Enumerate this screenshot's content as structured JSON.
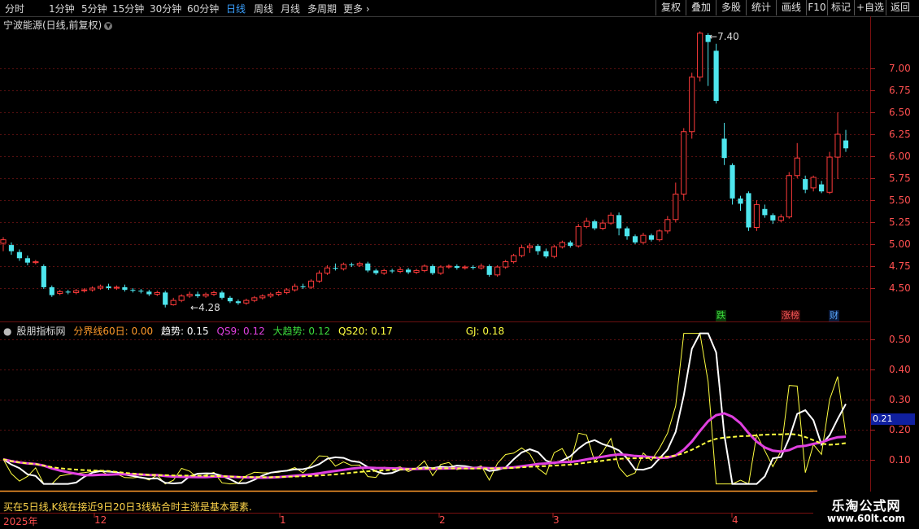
{
  "toolbar": {
    "periods": [
      "分时",
      "1分钟",
      "5分钟",
      "15分钟",
      "30分钟",
      "60分钟",
      "日线",
      "周线",
      "月线",
      "多周期",
      "更多"
    ],
    "active_period": "日线",
    "right_buttons": [
      "复权",
      "叠加",
      "多股",
      "统计",
      "画线",
      "F10",
      "标记",
      "+自选",
      "返回"
    ]
  },
  "chart_title": "宁波能源(日线,前复权)",
  "price_axis": [
    "7.00",
    "6.75",
    "6.50",
    "6.25",
    "6.00",
    "5.75",
    "5.50",
    "5.25",
    "5.00",
    "4.75",
    "4.50"
  ],
  "high_label": "7.40",
  "low_label": "4.28",
  "badges": [
    {
      "text": "跌",
      "color": "#3ddc3d",
      "bg": "#0a3a0a"
    },
    {
      "text": "涨榜",
      "color": "#ff5a5a",
      "bg": "#3a0a0a"
    },
    {
      "text": "财",
      "color": "#5aa8ff",
      "bg": "#0a1a3a"
    }
  ],
  "indicator": {
    "name": "股朋指标网",
    "fen_jie": "分界线60日: 0.00",
    "qu_shi_label": "趋势:",
    "qu_shi_value": "0.15",
    "qs9": "QS9: 0.12",
    "da_qu_shi": "大趋势: 0.12",
    "qs20": "QS20: 0.17",
    "gj": "GJ: 0.18",
    "axis": [
      "0.50",
      "0.40",
      "0.30",
      "0.20",
      "0.10"
    ],
    "current_value": "0.21"
  },
  "time_axis": [
    "2025年",
    "12",
    "1",
    "2",
    "3",
    "4"
  ],
  "bottom_text": "买在5日线,K线在接近9日20日3线粘合时主涨是基本要素.",
  "watermark": {
    "line1": "乐淘公式网",
    "line2": "www.60lt.com"
  },
  "colors": {
    "up": "#ff3b3b",
    "down": "#4ee6ee",
    "white": "#ffffff",
    "magenta": "#e040e0",
    "yellow": "#ffff40",
    "orange": "#ff9a2a"
  },
  "candles": [
    [
      5.01,
      5.05,
      4.92,
      5.08
    ],
    [
      4.99,
      4.92,
      4.88,
      5.02
    ],
    [
      4.91,
      4.84,
      4.81,
      4.94
    ],
    [
      4.84,
      4.79,
      4.76,
      4.87
    ],
    [
      4.79,
      4.8,
      4.77,
      4.82
    ],
    [
      4.75,
      4.51,
      4.49,
      4.77
    ],
    [
      4.51,
      4.42,
      4.4,
      4.53
    ],
    [
      4.44,
      4.46,
      4.42,
      4.48
    ],
    [
      4.46,
      4.45,
      4.43,
      4.48
    ],
    [
      4.45,
      4.47,
      4.43,
      4.49
    ],
    [
      4.47,
      4.48,
      4.45,
      4.5
    ],
    [
      4.48,
      4.5,
      4.46,
      4.52
    ],
    [
      4.5,
      4.52,
      4.48,
      4.54
    ],
    [
      4.52,
      4.5,
      4.48,
      4.55
    ],
    [
      4.5,
      4.51,
      4.48,
      4.53
    ],
    [
      4.51,
      4.48,
      4.46,
      4.54
    ],
    [
      4.48,
      4.47,
      4.45,
      4.5
    ],
    [
      4.47,
      4.46,
      4.44,
      4.49
    ],
    [
      4.46,
      4.43,
      4.41,
      4.48
    ],
    [
      4.43,
      4.45,
      4.41,
      4.47
    ],
    [
      4.45,
      4.31,
      4.28,
      4.47
    ],
    [
      4.31,
      4.36,
      4.3,
      4.39
    ],
    [
      4.36,
      4.41,
      4.34,
      4.43
    ],
    [
      4.41,
      4.43,
      4.39,
      4.46
    ],
    [
      4.43,
      4.41,
      4.39,
      4.46
    ],
    [
      4.41,
      4.43,
      4.39,
      4.45
    ],
    [
      4.43,
      4.45,
      4.41,
      4.47
    ],
    [
      4.45,
      4.39,
      4.37,
      4.47
    ],
    [
      4.39,
      4.35,
      4.33,
      4.41
    ],
    [
      4.35,
      4.33,
      4.31,
      4.37
    ],
    [
      4.33,
      4.36,
      4.31,
      4.38
    ],
    [
      4.36,
      4.39,
      4.34,
      4.41
    ],
    [
      4.39,
      4.41,
      4.37,
      4.43
    ],
    [
      4.41,
      4.43,
      4.39,
      4.45
    ],
    [
      4.43,
      4.45,
      4.41,
      4.47
    ],
    [
      4.45,
      4.48,
      4.43,
      4.5
    ],
    [
      4.48,
      4.52,
      4.46,
      4.55
    ],
    [
      4.52,
      4.51,
      4.49,
      4.55
    ],
    [
      4.51,
      4.58,
      4.49,
      4.6
    ],
    [
      4.58,
      4.67,
      4.56,
      4.7
    ],
    [
      4.67,
      4.73,
      4.65,
      4.76
    ],
    [
      4.73,
      4.72,
      4.7,
      4.78
    ],
    [
      4.72,
      4.77,
      4.7,
      4.79
    ],
    [
      4.77,
      4.76,
      4.74,
      4.79
    ],
    [
      4.76,
      4.78,
      4.74,
      4.8
    ],
    [
      4.78,
      4.7,
      4.68,
      4.8
    ],
    [
      4.7,
      4.67,
      4.65,
      4.72
    ],
    [
      4.67,
      4.7,
      4.65,
      4.72
    ],
    [
      4.7,
      4.69,
      4.67,
      4.72
    ],
    [
      4.69,
      4.71,
      4.67,
      4.74
    ],
    [
      4.71,
      4.68,
      4.66,
      4.73
    ],
    [
      4.68,
      4.7,
      4.66,
      4.72
    ],
    [
      4.7,
      4.75,
      4.68,
      4.77
    ],
    [
      4.75,
      4.67,
      4.65,
      4.77
    ],
    [
      4.67,
      4.74,
      4.65,
      4.76
    ],
    [
      4.74,
      4.75,
      4.72,
      4.77
    ],
    [
      4.75,
      4.73,
      4.71,
      4.77
    ],
    [
      4.73,
      4.74,
      4.71,
      4.76
    ],
    [
      4.74,
      4.73,
      4.71,
      4.76
    ],
    [
      4.73,
      4.75,
      4.71,
      4.78
    ],
    [
      4.75,
      4.65,
      4.63,
      4.77
    ],
    [
      4.65,
      4.74,
      4.63,
      4.76
    ],
    [
      4.74,
      4.8,
      4.72,
      4.82
    ],
    [
      4.8,
      4.87,
      4.78,
      4.89
    ],
    [
      4.87,
      4.96,
      4.85,
      4.99
    ],
    [
      4.96,
      4.98,
      4.9,
      5.01
    ],
    [
      4.98,
      4.92,
      4.88,
      5.0
    ],
    [
      4.92,
      4.86,
      4.84,
      4.95
    ],
    [
      4.86,
      4.97,
      4.84,
      4.99
    ],
    [
      4.97,
      5.02,
      4.95,
      5.04
    ],
    [
      5.02,
      4.98,
      4.96,
      5.04
    ],
    [
      4.98,
      5.2,
      4.96,
      5.23
    ],
    [
      5.2,
      5.26,
      5.18,
      5.3
    ],
    [
      5.26,
      5.18,
      5.16,
      5.28
    ],
    [
      5.18,
      5.24,
      5.16,
      5.28
    ],
    [
      5.24,
      5.33,
      5.22,
      5.36
    ],
    [
      5.33,
      5.18,
      5.1,
      5.36
    ],
    [
      5.18,
      5.09,
      5.05,
      5.2
    ],
    [
      5.09,
      5.02,
      5.0,
      5.11
    ],
    [
      5.02,
      5.1,
      5.0,
      5.13
    ],
    [
      5.1,
      5.05,
      5.03,
      5.12
    ],
    [
      5.05,
      5.15,
      5.03,
      5.17
    ],
    [
      5.15,
      5.28,
      5.12,
      5.32
    ],
    [
      5.28,
      5.57,
      5.25,
      5.7
    ],
    [
      5.57,
      6.28,
      5.5,
      6.32
    ],
    [
      6.28,
      6.9,
      6.2,
      6.95
    ],
    [
      6.9,
      7.4,
      6.85,
      7.42
    ],
    [
      7.38,
      7.3,
      6.8,
      7.4
    ],
    [
      7.2,
      6.63,
      6.6,
      7.28
    ],
    [
      6.2,
      5.98,
      5.9,
      6.38
    ],
    [
      5.9,
      5.52,
      5.45,
      5.92
    ],
    [
      5.52,
      5.46,
      5.38,
      5.55
    ],
    [
      5.58,
      5.19,
      5.15,
      5.6
    ],
    [
      5.19,
      5.45,
      5.15,
      5.5
    ],
    [
      5.4,
      5.33,
      5.3,
      5.45
    ],
    [
      5.33,
      5.27,
      5.23,
      5.35
    ],
    [
      5.27,
      5.31,
      5.25,
      5.34
    ],
    [
      5.31,
      5.78,
      5.29,
      5.82
    ],
    [
      5.78,
      5.98,
      5.75,
      6.15
    ],
    [
      5.74,
      5.62,
      5.58,
      5.78
    ],
    [
      5.64,
      5.76,
      5.6,
      5.78
    ],
    [
      5.68,
      5.6,
      5.58,
      5.72
    ],
    [
      5.59,
      5.99,
      5.57,
      6.05
    ],
    [
      5.99,
      6.25,
      5.74,
      6.5
    ],
    [
      6.18,
      6.09,
      6.05,
      6.3
    ]
  ]
}
